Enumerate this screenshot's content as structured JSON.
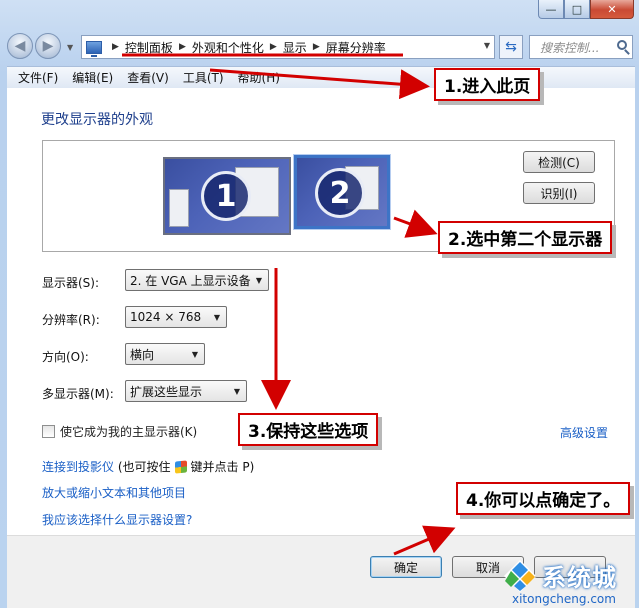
{
  "window": {
    "caption": {
      "minimize": "—",
      "maximize": "□",
      "close": "✕"
    }
  },
  "nav": {
    "breadcrumbs": [
      "控制面板",
      "外观和个性化",
      "显示",
      "屏幕分辨率"
    ],
    "search_placeholder": "搜索控制..."
  },
  "menu": [
    "文件(F)",
    "编辑(E)",
    "查看(V)",
    "工具(T)",
    "帮助(H)"
  ],
  "page": {
    "title": "更改显示器的外观",
    "detect_button": "检测(C)",
    "identify_button": "识别(I)",
    "monitors": [
      "1",
      "2"
    ],
    "display_label": "显示器(S):",
    "display_value": "2. 在 VGA 上显示设备",
    "resolution_label": "分辨率(R):",
    "resolution_value": "1024 × 768",
    "orientation_label": "方向(O):",
    "orientation_value": "横向",
    "multi_label": "多显示器(M):",
    "multi_value": "扩展这些显示",
    "primary_checkbox": "使它成为我的主显示器(K)",
    "advanced_link": "高级设置",
    "projector_link": "连接到投影仪",
    "projector_hint_pre": "(也可按住",
    "projector_hint_post": "键并点击 P)",
    "text_size_link": "放大或缩小文本和其他项目",
    "help_link": "我应该选择什么显示器设置?"
  },
  "footer": {
    "ok": "确定",
    "cancel": "取消"
  },
  "annotations": {
    "step1": "1.进入此页",
    "step2": "2.选中第二个显示器",
    "step3": "3.保持这些选项",
    "step4": "4.你可以点确定了。"
  },
  "watermark": {
    "brand": "系统城",
    "url": "xitongcheng.com"
  },
  "colors": {
    "annotation_red": "#d20000",
    "link_blue": "#1a5fc6",
    "title_blue": "#1e3f8c"
  }
}
